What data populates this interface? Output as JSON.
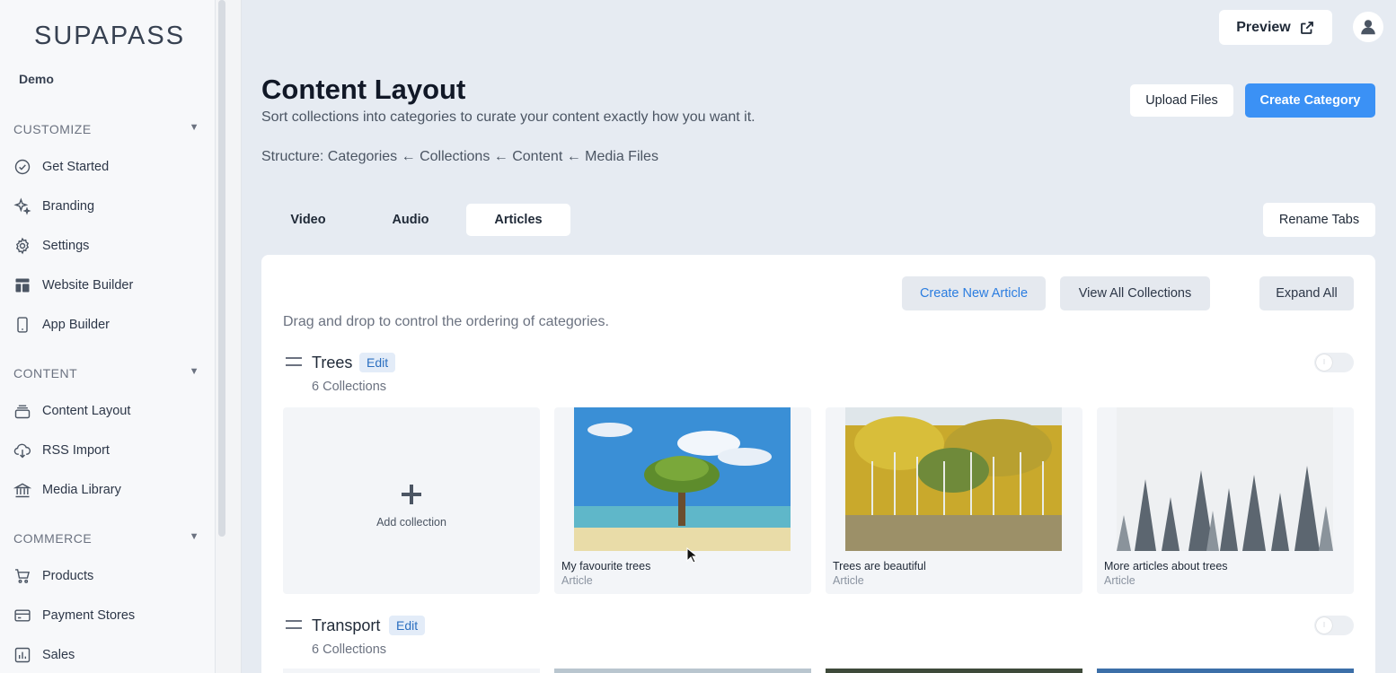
{
  "brand": {
    "logo": "SUPAPASS",
    "org": "Demo",
    "accent": "#3b91f5"
  },
  "sidebar": {
    "sections": [
      {
        "label": "CUSTOMIZE",
        "items": [
          "Get Started",
          "Branding",
          "Settings",
          "Website Builder",
          "App Builder"
        ]
      },
      {
        "label": "CONTENT",
        "items": [
          "Content Layout",
          "RSS Import",
          "Media Library"
        ]
      },
      {
        "label": "COMMERCE",
        "items": [
          "Products",
          "Payment Stores",
          "Sales"
        ]
      }
    ],
    "icons": [
      "check-circle-icon",
      "sparkle-icon",
      "gear-icon",
      "layout-icon",
      "mobile-icon",
      "layers-icon",
      "cloud-download-icon",
      "bank-icon",
      "cart-icon",
      "credit-card-icon",
      "bar-chart-icon"
    ]
  },
  "topbar": {
    "preview_label": "Preview"
  },
  "header": {
    "title": "Content Layout",
    "subtitle": "Sort collections into categories to curate your content exactly how you want it.",
    "structure": "Structure: Categories ← Collections ← Content ← Media Files",
    "upload_label": "Upload Files",
    "create_category_label": "Create Category"
  },
  "tabs": {
    "items": [
      "Video",
      "Audio",
      "Articles"
    ],
    "active": "Articles",
    "rename_label": "Rename Tabs"
  },
  "panel": {
    "create_article_label": "Create New Article",
    "view_collections_label": "View All Collections",
    "expand_label": "Expand All",
    "hint": "Drag and drop to control the ordering of categories.",
    "add_collection_label": "Add collection",
    "edit_label": "Edit",
    "categories": [
      {
        "title": "Trees",
        "count": "6 Collections",
        "collections": [
          {
            "title": "My favourite trees",
            "type": "Article"
          },
          {
            "title": "Trees are beautiful",
            "type": "Article"
          },
          {
            "title": "More articles about trees",
            "type": "Article"
          }
        ]
      },
      {
        "title": "Transport",
        "count": "6 Collections"
      }
    ]
  }
}
